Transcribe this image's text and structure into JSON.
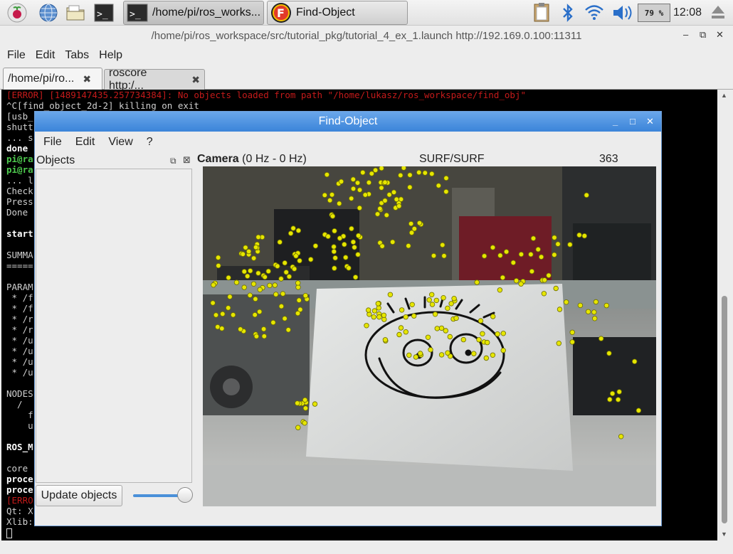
{
  "taskbar": {
    "tasks": [
      {
        "label": "/home/pi/ros_works..."
      },
      {
        "label": "Find-Object"
      }
    ],
    "battery": "79 %",
    "clock": "12:08"
  },
  "terminal": {
    "window_title": "/home/pi/ros_workspace/src/tutorial_pkg/tutorial_4_ex_1.launch http://192.169.0.100:11311",
    "menu": [
      "File",
      "Edit",
      "Tabs",
      "Help"
    ],
    "tabs": [
      {
        "label": "/home/pi/ro...",
        "close": "✖"
      },
      {
        "label": "roscore http:/...",
        "close": "✖"
      }
    ],
    "close_symbol": "✕",
    "lines": [
      {
        "text": "[ERROR] [1489147435.257734384]: No objects loaded from path \"/home/lukasz/ros_workspace/find_obj\"",
        "style": "red"
      },
      {
        "text": "^C[find_object_2d-2] killing on exit",
        "style": ""
      },
      {
        "text": "[usb_",
        "style": ""
      },
      {
        "text": "shutt",
        "style": ""
      },
      {
        "text": "... s",
        "style": ""
      },
      {
        "text": "done",
        "style": "bold"
      },
      {
        "text": "pi@ra",
        "style": "green"
      },
      {
        "text": "pi@ra",
        "style": "green"
      },
      {
        "text": "... l",
        "style": ""
      },
      {
        "text": "Check",
        "style": ""
      },
      {
        "text": "Press",
        "style": ""
      },
      {
        "text": "Done",
        "style": ""
      },
      {
        "text": "",
        "style": ""
      },
      {
        "text": "start",
        "style": "bold"
      },
      {
        "text": "",
        "style": ""
      },
      {
        "text": "SUMMA",
        "style": ""
      },
      {
        "text": "=====",
        "style": ""
      },
      {
        "text": "",
        "style": ""
      },
      {
        "text": "PARAM",
        "style": ""
      },
      {
        "text": " * /f",
        "style": ""
      },
      {
        "text": " * /f",
        "style": ""
      },
      {
        "text": " * /r",
        "style": ""
      },
      {
        "text": " * /r",
        "style": ""
      },
      {
        "text": " * /u",
        "style": ""
      },
      {
        "text": " * /u",
        "style": ""
      },
      {
        "text": " * /u",
        "style": ""
      },
      {
        "text": " * /u",
        "style": ""
      },
      {
        "text": "",
        "style": ""
      },
      {
        "text": "NODES",
        "style": ""
      },
      {
        "text": "  /",
        "style": ""
      },
      {
        "text": "    f",
        "style": ""
      },
      {
        "text": "    u",
        "style": ""
      },
      {
        "text": "",
        "style": ""
      },
      {
        "text": "ROS_M",
        "style": "bold"
      },
      {
        "text": "",
        "style": ""
      },
      {
        "text": "core",
        "style": ""
      },
      {
        "text": "proce",
        "style": "bold"
      },
      {
        "text": "proce",
        "style": "bold"
      },
      {
        "text": "[ERRO",
        "style": "red"
      },
      {
        "text": "Qt: X",
        "style": ""
      },
      {
        "text": "Xlib:",
        "style": ""
      }
    ]
  },
  "find_object": {
    "window_title": "Find-Object",
    "menu": [
      "File",
      "Edit",
      "View",
      "?"
    ],
    "objects_title": "Objects",
    "update_button": "Update objects",
    "threshold_slider": 1.0,
    "camera": {
      "label": "Camera",
      "rate": "(0 Hz - 0 Hz)",
      "detector": "SURF/SURF",
      "features": "363 features"
    }
  },
  "colors": {
    "title_bar": "#4a90e2",
    "terminal_bg": "#000000",
    "error_text": "#c41a1a",
    "prompt_text": "#4fcd4f",
    "feature_point": "#e6e600"
  }
}
